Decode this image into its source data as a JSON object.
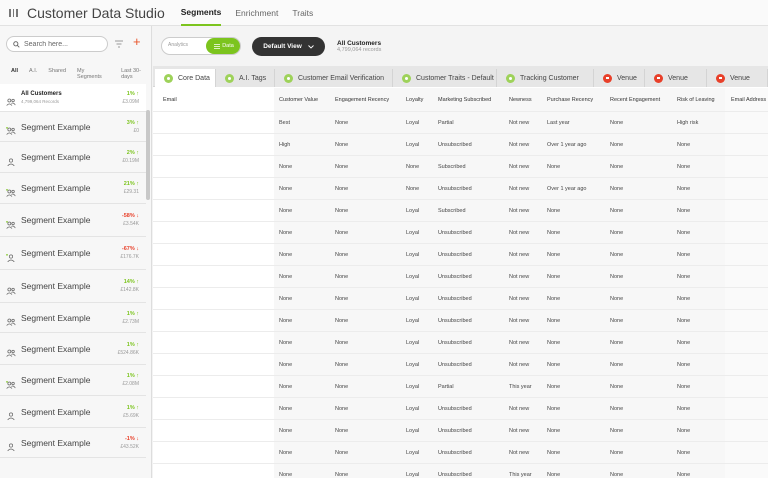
{
  "app": {
    "title": "Customer Data Studio",
    "menu_icon": "menu-icon"
  },
  "nav_tabs": [
    {
      "label": "Segments",
      "active": true
    },
    {
      "label": "Enrichment",
      "active": false
    },
    {
      "label": "Traits",
      "active": false
    }
  ],
  "sidebar": {
    "search_placeholder": "Search here...",
    "filters": [
      "All",
      "A.I.",
      "Shared",
      "My Segments",
      "Last 30-days"
    ],
    "segments": [
      {
        "name": "All Customers",
        "sub": "4,799,064 Records",
        "change": "1% ↑",
        "count": "£3.09M",
        "trend": "up",
        "icon": "group-icon"
      },
      {
        "name": "Segment Example",
        "change": "3% ↑",
        "count": "£0",
        "trend": "up",
        "icon": "ai-group-icon"
      },
      {
        "name": "Segment Example",
        "change": "2% ↑",
        "count": "£0.19M",
        "trend": "up",
        "icon": "person-icon"
      },
      {
        "name": "Segment Example",
        "change": "21% ↑",
        "count": "£29.31",
        "trend": "up",
        "icon": "ai-group-icon"
      },
      {
        "name": "Segment Example",
        "change": "-58% ↓",
        "count": "£3.54K",
        "trend": "down",
        "icon": "ai-group-icon"
      },
      {
        "name": "Segment Example",
        "change": "-67% ↓",
        "count": "£176.7K",
        "trend": "down",
        "icon": "ai-person-icon"
      },
      {
        "name": "Segment Example",
        "change": "14% ↑",
        "count": "£142.8K",
        "trend": "up",
        "icon": "group-icon"
      },
      {
        "name": "Segment Example",
        "change": "1% ↑",
        "count": "£2.73M",
        "trend": "up",
        "icon": "group-icon"
      },
      {
        "name": "Segment Example",
        "change": "1% ↑",
        "count": "£524.86K",
        "trend": "up",
        "icon": "group-icon"
      },
      {
        "name": "Segment Example",
        "change": "1% ↑",
        "count": "£2.08M",
        "trend": "up",
        "icon": "ai-group-icon"
      },
      {
        "name": "Segment Example",
        "change": "1% ↑",
        "count": "£5.69K",
        "trend": "up",
        "icon": "person-icon"
      },
      {
        "name": "Segment Example",
        "change": "-1% ↓",
        "count": "£43.52K",
        "trend": "down",
        "icon": "person-icon"
      }
    ]
  },
  "toolbar": {
    "analytics_label": "Analytics",
    "data_label": "Data",
    "default_view_label": "Default View",
    "summary_title": "All Customers",
    "summary_count": "4,799,064 records"
  },
  "data_tabs": [
    {
      "label": "Core Data",
      "status": "green",
      "active": true
    },
    {
      "label": "A.I. Tags",
      "status": "green",
      "active": false
    },
    {
      "label": "Customer Email Verification",
      "status": "green",
      "active": false
    },
    {
      "label": "Customer Traits - Default",
      "status": "green",
      "active": false
    },
    {
      "label": "Tracking Customer",
      "status": "green",
      "active": false
    },
    {
      "label": "Venue",
      "status": "red",
      "active": false
    },
    {
      "label": "Venue",
      "status": "red",
      "active": false
    },
    {
      "label": "Venue",
      "status": "red",
      "active": false
    }
  ],
  "table": {
    "columns": [
      "Email",
      "Customer Value",
      "Engagement Recency",
      "Loyalty",
      "Marketing Subscribed",
      "Newness",
      "Purchase Recency",
      "Recent Engagement",
      "Risk of Leaving",
      "Email Address"
    ],
    "rows": [
      [
        "",
        "Best",
        "None",
        "Loyal",
        "Partial",
        "Not new",
        "Last year",
        "None",
        "High risk",
        ""
      ],
      [
        "",
        "High",
        "None",
        "Loyal",
        "Unsubscribed",
        "Not new",
        "Over 1 year ago",
        "None",
        "None",
        ""
      ],
      [
        "",
        "None",
        "None",
        "None",
        "Subscribed",
        "Not new",
        "None",
        "None",
        "None",
        ""
      ],
      [
        "",
        "None",
        "None",
        "None",
        "Unsubscribed",
        "Not new",
        "Over 1 year ago",
        "None",
        "None",
        ""
      ],
      [
        "",
        "None",
        "None",
        "Loyal",
        "Subscribed",
        "Not new",
        "None",
        "None",
        "None",
        ""
      ],
      [
        "",
        "None",
        "None",
        "Loyal",
        "Unsubscribed",
        "Not new",
        "None",
        "None",
        "None",
        ""
      ],
      [
        "",
        "None",
        "None",
        "Loyal",
        "Unsubscribed",
        "Not new",
        "None",
        "None",
        "None",
        ""
      ],
      [
        "",
        "None",
        "None",
        "Loyal",
        "Unsubscribed",
        "Not new",
        "None",
        "None",
        "None",
        ""
      ],
      [
        "",
        "None",
        "None",
        "Loyal",
        "Unsubscribed",
        "Not new",
        "None",
        "None",
        "None",
        ""
      ],
      [
        "",
        "None",
        "None",
        "Loyal",
        "Unsubscribed",
        "Not new",
        "None",
        "None",
        "None",
        ""
      ],
      [
        "",
        "None",
        "None",
        "Loyal",
        "Unsubscribed",
        "Not new",
        "None",
        "None",
        "None",
        ""
      ],
      [
        "",
        "None",
        "None",
        "Loyal",
        "Unsubscribed",
        "Not new",
        "None",
        "None",
        "None",
        ""
      ],
      [
        "",
        "None",
        "None",
        "Loyal",
        "Partial",
        "This year",
        "None",
        "None",
        "None",
        ""
      ],
      [
        "",
        "None",
        "None",
        "Loyal",
        "Unsubscribed",
        "Not new",
        "None",
        "None",
        "None",
        ""
      ],
      [
        "",
        "None",
        "None",
        "Loyal",
        "Unsubscribed",
        "Not new",
        "None",
        "None",
        "None",
        ""
      ],
      [
        "",
        "None",
        "None",
        "Loyal",
        "Unsubscribed",
        "Not new",
        "None",
        "None",
        "None",
        ""
      ],
      [
        "",
        "None",
        "None",
        "Loyal",
        "Unsubscribed",
        "This year",
        "None",
        "None",
        "None",
        ""
      ]
    ]
  },
  "colors": {
    "accent": "#7cc41e",
    "negative": "#e8402a",
    "dark_button": "#333333"
  }
}
